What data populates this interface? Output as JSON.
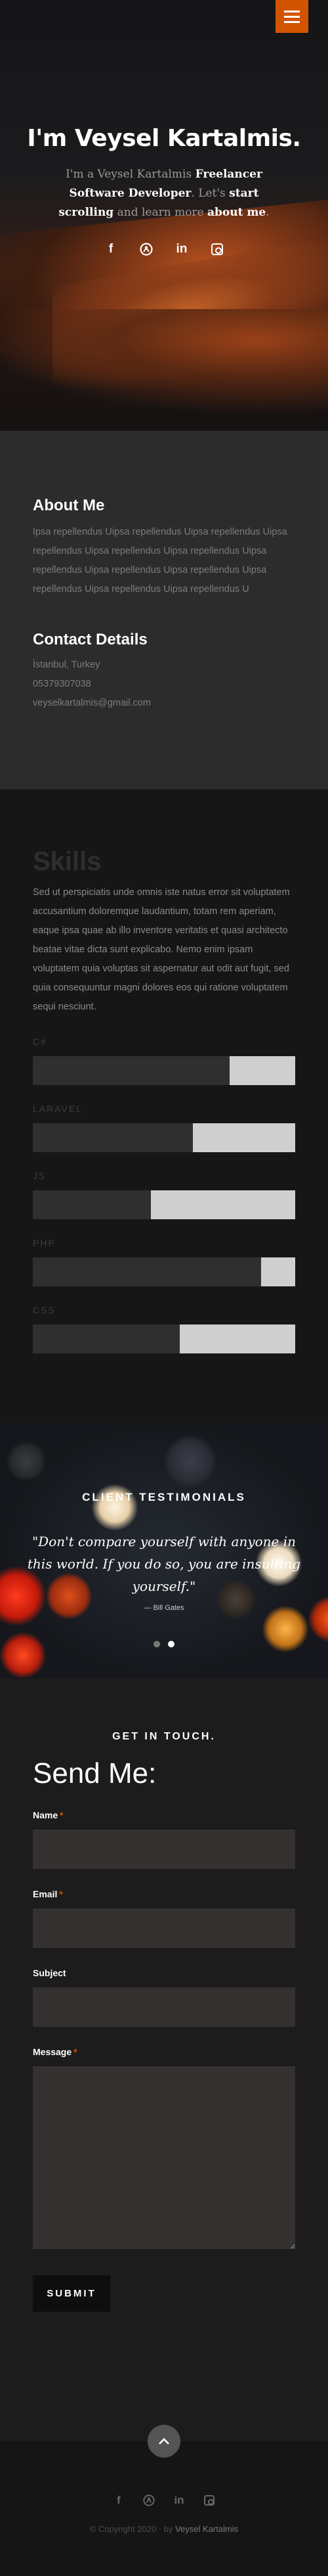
{
  "hero": {
    "title": "I'm Veysel Kartalmis.",
    "subtitle_parts": [
      "I'm a Veysel Kartalmis ",
      "Freelancer Software Developer",
      ". Let's ",
      "start scrolling",
      " and learn more ",
      "about me",
      "."
    ],
    "social_icons": [
      "facebook-icon",
      "github-icon",
      "linkedin-icon",
      "instagram-icon"
    ],
    "social_glyphs": [
      "f",
      "◯",
      "in",
      ""
    ]
  },
  "about": {
    "heading": "About Me",
    "text": "Ipsa repellendus Uipsa repellendus Uipsa repellendus Uipsa repellendus Uipsa repellendus Uipsa repellendus Uipsa repellendus Uipsa repellendus Uipsa repellendus Uipsa repellendus Uipsa repellendus Uipsa repellendus U",
    "contact_heading": "Contact Details",
    "city": "İstanbul, Turkey",
    "phone": "05379307038",
    "email": "veyselkartalmis@gmail.com"
  },
  "skills": {
    "heading": "Skills",
    "text": "Sed ut perspiciatis unde omnis iste natus error sit voluptatem accusantium doloremque laudantium, totam rem aperiam, eaque ipsa quae ab illo inventore veritatis et quasi architecto beatae vitae dicta sunt explicabo. Nemo enim ipsam voluptatem quia voluptas sit aspernatur aut odit aut fugit, sed quia consequuntur magni dolores eos qui ratione voluptatem sequi nesciunt.",
    "items": [
      {
        "name": "C#",
        "level": 0.75
      },
      {
        "name": "LARAVEL",
        "level": 0.61
      },
      {
        "name": "JS",
        "level": 0.45
      },
      {
        "name": "PHP",
        "level": 0.87
      },
      {
        "name": "CSS",
        "level": 0.56
      }
    ]
  },
  "testimonials": {
    "heading": "CLIENT TESTIMONIALS",
    "quote": "\"Don't compare yourself with anyone in this world. If you do so, you are insulting yourself.\"",
    "author": "— Bill Gates",
    "active_slide": 1,
    "slide_count": 2
  },
  "contact_form": {
    "kicker": "GET IN TOUCH.",
    "title": "Send Me:",
    "name_label": "Name",
    "email_label": "Email",
    "subject_label": "Subject",
    "message_label": "Message",
    "required_mark": "*",
    "name_value": "",
    "email_value": "",
    "subject_value": "",
    "message_value": "",
    "submit_label": "SUBMIT"
  },
  "footer": {
    "copyright_prefix": "© Copyright 2020 · by ",
    "copyright_name": "Veysel Kartalmis"
  },
  "colors": {
    "accent": "#d35400",
    "hero_bg": "#151517",
    "about_bg": "#2c2c2c",
    "skills_bg": "#161616",
    "skill_fill": "#cfcfcf",
    "form_bg": "#1c1c1c"
  }
}
